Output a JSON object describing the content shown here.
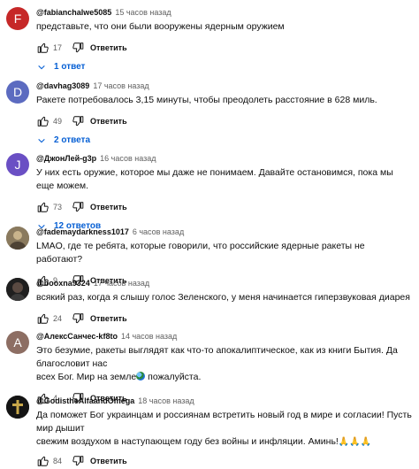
{
  "labels": {
    "reply": "Ответить"
  },
  "colors": {
    "link_blue": "#065fd4",
    "meta_gray": "#606060"
  },
  "comments": [
    {
      "author": "@fabianchalwe5085",
      "time": "15 часов назад",
      "avatar": {
        "letter": "F",
        "color": "#c62828"
      },
      "text": "представьте, что они были вооружены ядерным оружием",
      "likes": "17",
      "replies": "1 ответ"
    },
    {
      "author": "@davhag3089",
      "time": "17 часов назад",
      "avatar": {
        "letter": "D",
        "color": "#5c6bc0"
      },
      "text": "Ракете потребовалось 3,15 минуты, чтобы преодолеть расстояние в 628 миль.",
      "likes": "49",
      "replies": "2 ответа"
    },
    {
      "author": "@ДжонЛей-g3p",
      "time": "16 часов назад",
      "avatar": {
        "letter": "J",
        "color": "#6a4fc4"
      },
      "text": "У них есть оружие, которое мы даже не понимаем. Давайте остановимся, пока мы еще можем.",
      "likes": "73",
      "replies": "12 ответов"
    },
    {
      "author": "@fademaydarkness1017",
      "time": "6 часов назад",
      "avatar": {
        "type": "image",
        "icon": "photo-avatar"
      },
      "text": "LMAO, где те ребята, которые говорили, что российские ядерные ракеты не работают?",
      "likes": "9"
    },
    {
      "author": "@booxna9324",
      "time": "17 часов назад",
      "avatar": {
        "type": "image",
        "icon": "photo-avatar"
      },
      "text": "всякий раз, когда я слышу голос Зеленского, у меня начинается гиперзвуковая диарея",
      "likes": "24"
    },
    {
      "author": "@АлексСанчес-kf8to",
      "time": "14 часов назад",
      "avatar": {
        "letter": "A",
        "color": "#8d6e63"
      },
      "text_line1": "Это безумие, ракеты выглядят как что-то апокалиптическое, как из книги Бытия. Да благословит нас",
      "text_line2": "всех Бог. Мир на земле",
      "text_tail": " пожалуйста.",
      "likes": "4"
    },
    {
      "author": "@GodistheAlfaandOmega",
      "time": "18 часов назад",
      "avatar": {
        "type": "image",
        "icon": "cross-avatar"
      },
      "text_line1": "Да поможет Бог украинцам и россиянам встретить новый год в мире и согласии! Пусть мир дышит",
      "text_line2": "свежим воздухом в наступающем году без войны и инфляции. Аминь!",
      "emoji": "🙏🙏🙏",
      "likes": "84"
    }
  ]
}
